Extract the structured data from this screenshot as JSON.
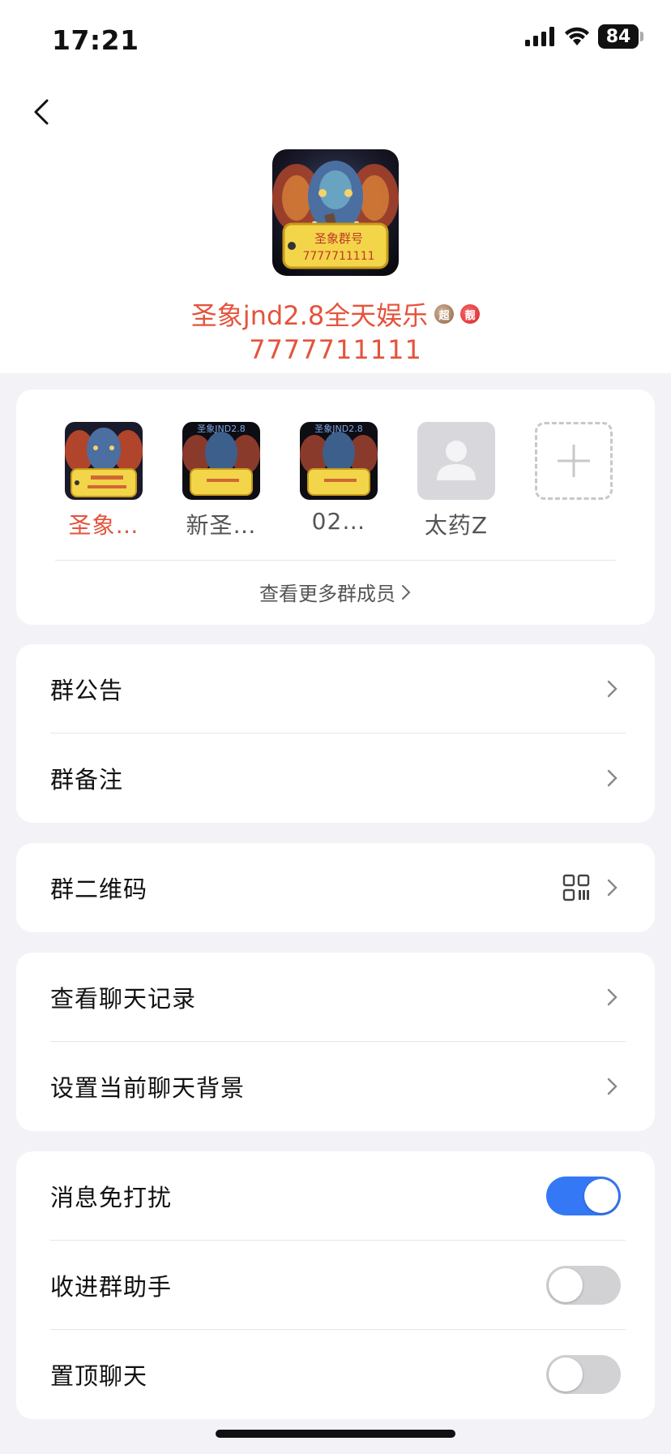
{
  "status_bar": {
    "time": "17:21",
    "battery": "84"
  },
  "group": {
    "name": "圣象jnd2.8全天娱乐",
    "number": "7777711111",
    "avatar_tag_title": "圣象群号",
    "avatar_tag_number": "7777711111",
    "badges": {
      "super": "超",
      "pretty": "靓"
    }
  },
  "members": {
    "items": [
      {
        "name": "圣象…",
        "self": true
      },
      {
        "name": "新圣…"
      },
      {
        "name": "02…"
      },
      {
        "name": "太药Z"
      }
    ],
    "avatar_overlay_text": "圣象JND2.8",
    "more_label": "查看更多群成员"
  },
  "settings": {
    "announcement": "群公告",
    "remark": "群备注",
    "qr_code": "群二维码",
    "chat_history": "查看聊天记录",
    "chat_background": "设置当前聊天背景",
    "mute": {
      "label": "消息免打扰",
      "on": true
    },
    "assistant": {
      "label": "收进群助手",
      "on": false
    },
    "pin": {
      "label": "置顶聊天",
      "on": false
    }
  },
  "colors": {
    "accent_red": "#e5533c",
    "toggle_on": "#3478f6",
    "toggle_off": "#d2d2d4",
    "background": "#f2f2f7"
  }
}
